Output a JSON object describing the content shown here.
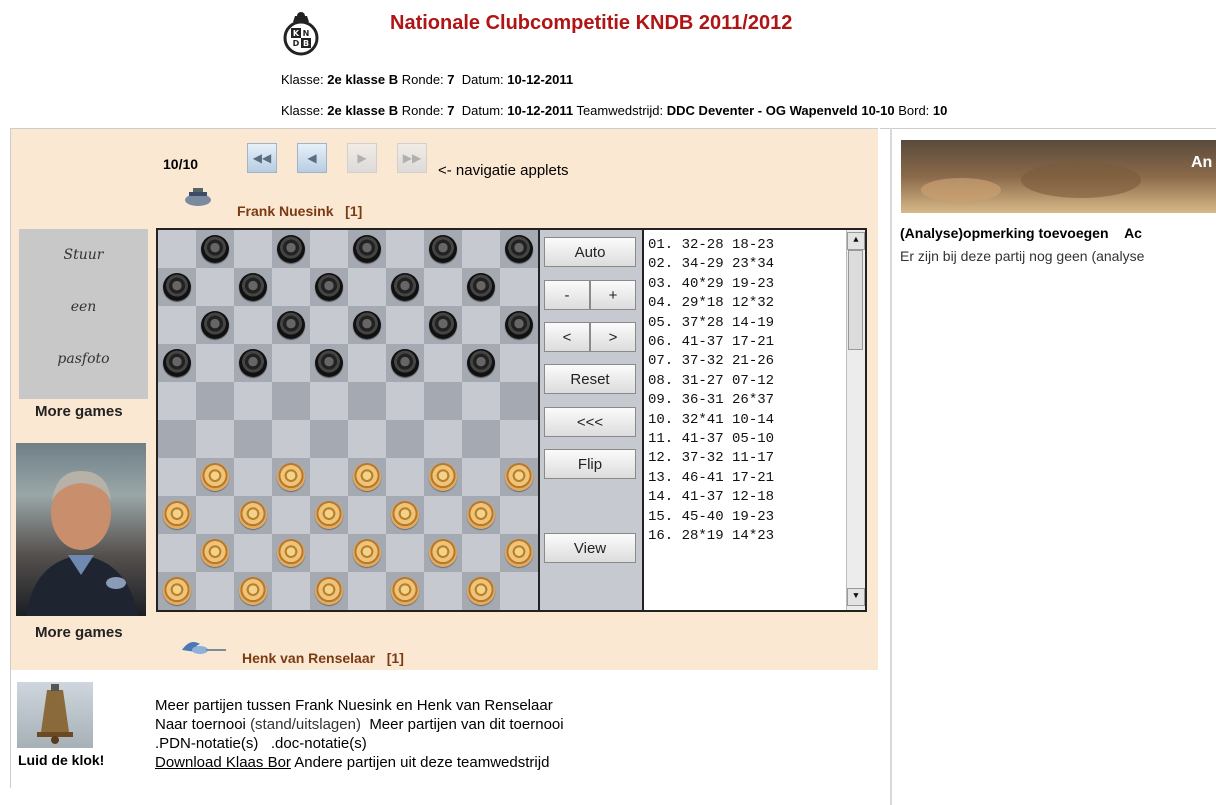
{
  "header": {
    "title": "Nationale Clubcompetitie KNDB 2011/2012",
    "logo_letters": [
      "K",
      "N",
      "D",
      "B"
    ],
    "line1": {
      "klasse_label": "Klasse:",
      "klasse": "2e klasse B",
      "ronde_label": "Ronde:",
      "ronde": "7",
      "datum_label": "Datum:",
      "datum": "10-12-2011"
    },
    "line2": {
      "klasse_label": "Klasse:",
      "klasse": "2e klasse B",
      "ronde_label": "Ronde:",
      "ronde": "7",
      "datum_label": "Datum:",
      "datum": "10-12-2011",
      "team_label": "Teamwedstrijd:",
      "team": "DDC Deventer - OG Wapenveld 10-10",
      "bord_label": "Bord:",
      "bord": "10"
    }
  },
  "nav": {
    "counter": "10/10",
    "note": "<- navigatie applets",
    "buttons": [
      "first-icon",
      "prev-icon",
      "next-icon",
      "last-icon"
    ]
  },
  "players": {
    "top": {
      "name": "Frank Nuesink",
      "rank": "[1]"
    },
    "bottom": {
      "name": "Henk van Renselaar",
      "rank": "[1]"
    }
  },
  "photo_placeholder": {
    "lines": [
      "Stuur",
      "een",
      "pasfoto"
    ]
  },
  "more_games": "More games",
  "controls": {
    "auto": "Auto",
    "minus": "-",
    "plus": "+",
    "prev": "<",
    "next": ">",
    "reset": "Reset",
    "back": "<<<",
    "flip": "Flip",
    "view": "View"
  },
  "moves": [
    "01. 32-28 18-23",
    "02. 34-29 23*34",
    "03. 40*29 19-23",
    "04. 29*18 12*32",
    "05. 37*28 14-19",
    "06. 41-37 17-21",
    "07. 37-32 21-26",
    "08. 31-27 07-12",
    "09. 36-31 26*37",
    "10. 32*41 10-14",
    "11. 41-37 05-10",
    "12. 37-32 11-17",
    "13. 46-41 17-21",
    "14. 41-37 12-18",
    "15. 45-40 19-23",
    "16. 28*19 14*23"
  ],
  "board": {
    "black_rows": [
      0,
      1,
      2,
      3
    ],
    "white_rows": [
      6,
      7,
      8,
      9
    ],
    "colors": {
      "light": "#c6c9cf",
      "dark": "#a5a9b1"
    }
  },
  "bottom": {
    "bell_label": "Luid de klok!",
    "line1": "Meer partijen tussen Frank Nuesink en Henk van Renselaar",
    "line2_a": "Naar toernooi",
    "line2_b": "(stand/uitslagen)",
    "line2_c": "Meer partijen van dit toernooi",
    "line3_a": ".PDN-notatie(s)",
    "line3_b": ".doc-notatie(s)",
    "line4_a": "Download Klaas Bor",
    "line4_b": "Andere partijen uit deze teamwedstrijd"
  },
  "right": {
    "banner_text": "An",
    "action1": "(Analyse)opmerking toevoegen",
    "action2": "Ac",
    "note": "Er zijn bij deze partij nog geen (analyse"
  }
}
